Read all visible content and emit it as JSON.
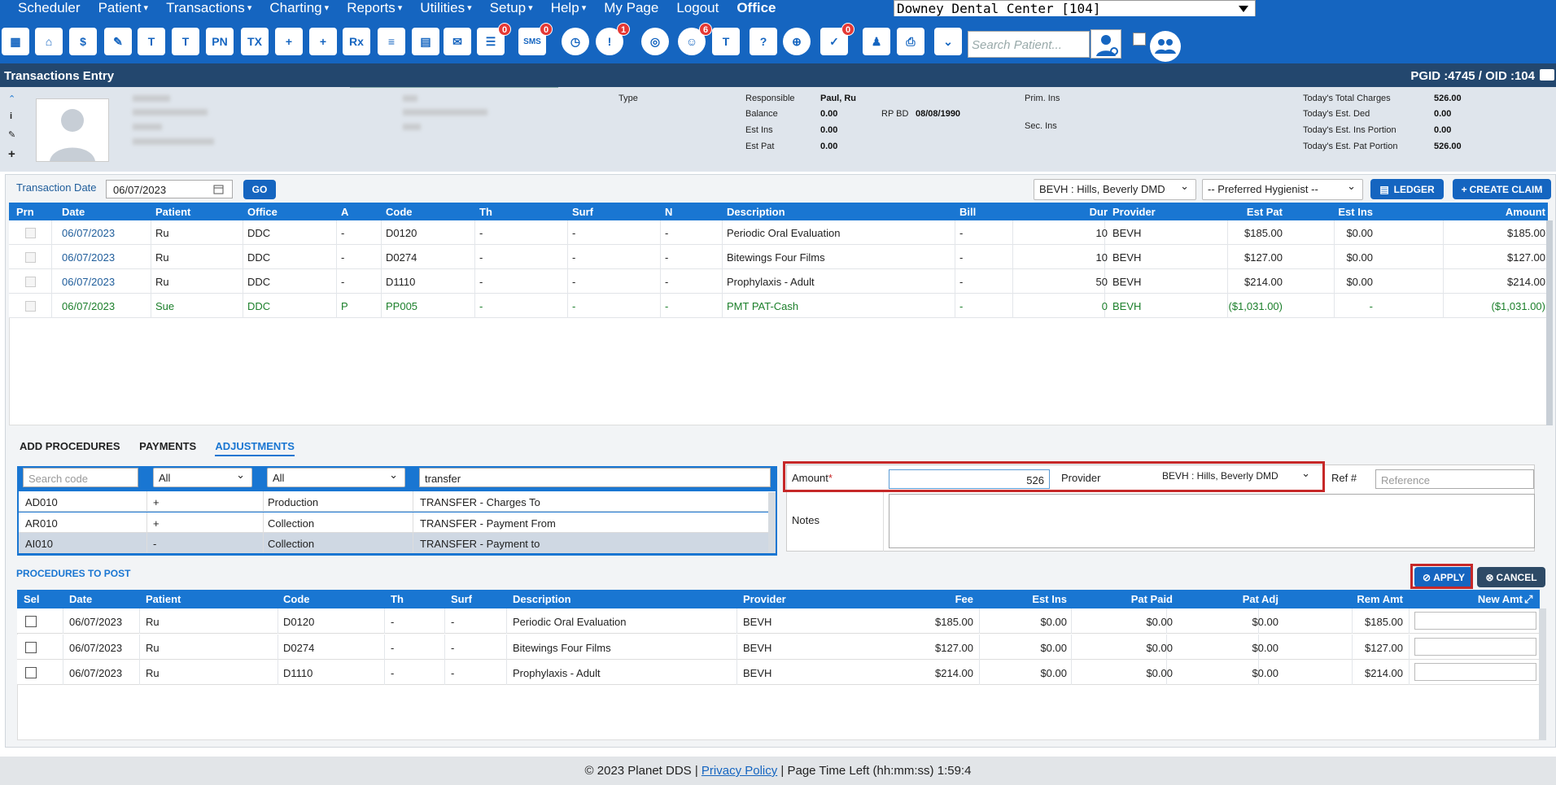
{
  "menu": {
    "items": [
      "Scheduler",
      "Patient",
      "Transactions",
      "Charting",
      "Reports",
      "Utilities",
      "Setup",
      "Help",
      "My Page",
      "Logout"
    ],
    "office_label": "Office",
    "office_value": "Downey Dental Center [104]"
  },
  "toolbar": {
    "search_placeholder": "Search Patient...",
    "icons": [
      {
        "name": "calendar-icon",
        "glyph": "▦"
      },
      {
        "name": "home-icon",
        "glyph": "⌂"
      },
      {
        "name": "dollar-refresh-icon",
        "glyph": "$"
      },
      {
        "name": "edit-notes-icon",
        "glyph": "✎"
      },
      {
        "name": "tooth-icon",
        "glyph": "T"
      },
      {
        "name": "tooth-chart-icon",
        "glyph": "T"
      },
      {
        "name": "progress-notes-icon",
        "glyph": "PN"
      },
      {
        "name": "treatment-icon",
        "glyph": "TX"
      },
      {
        "name": "add-patient-icon",
        "glyph": "+"
      },
      {
        "name": "add-family-icon",
        "glyph": "+"
      },
      {
        "name": "prescription-icon",
        "glyph": "Rx"
      },
      {
        "name": "message-icon",
        "glyph": "≡"
      },
      {
        "name": "print-document-icon",
        "glyph": "▤"
      },
      {
        "name": "email-icon",
        "glyph": "✉"
      },
      {
        "name": "chat-icon",
        "glyph": "☰"
      },
      {
        "name": "sms-icon",
        "glyph": "SMS"
      },
      {
        "name": "clock-icon",
        "glyph": "◷"
      },
      {
        "name": "alerts-icon",
        "glyph": "!"
      },
      {
        "name": "network-icon",
        "glyph": "◎"
      },
      {
        "name": "patient-status-icon",
        "glyph": "☺"
      },
      {
        "name": "tooth-outline-icon",
        "glyph": "T"
      },
      {
        "name": "tooth-help-icon",
        "glyph": "?"
      },
      {
        "name": "globe-icon",
        "glyph": "⊕"
      },
      {
        "name": "checklist-icon",
        "glyph": "✓"
      },
      {
        "name": "users-icon",
        "glyph": "♟"
      },
      {
        "name": "printer-icon",
        "glyph": "⎙"
      },
      {
        "name": "collapse-down-icon",
        "glyph": "⌄"
      }
    ],
    "badges": {
      "chat": "0",
      "sms": "0",
      "alerts": "1",
      "patient_status": "6",
      "checklist": "0"
    }
  },
  "title": {
    "text": "Transactions Entry",
    "ids": "PGID :4745  /  OID :104"
  },
  "patient_panel": {
    "type_label": "Type",
    "responsible_label": "Responsible",
    "responsible": "Paul, Ru",
    "balance_label": "Balance",
    "balance": "0.00",
    "rpbd_label": "RP BD",
    "rpbd": "08/08/1990",
    "estins_label": "Est Ins",
    "estins": "0.00",
    "estpat_label": "Est Pat",
    "estpat": "0.00",
    "primins_label": "Prim. Ins",
    "secins_label": "Sec. Ins",
    "today_charges_label": "Today's Total Charges",
    "today_charges": "526.00",
    "today_ded_label": "Today's Est. Ded",
    "today_ded": "0.00",
    "today_ins_label": "Today's Est. Ins Portion",
    "today_ins": "0.00",
    "today_pat_label": "Today's Est. Pat Portion",
    "today_pat": "526.00"
  },
  "entry": {
    "date_label": "Transaction Date",
    "date": "06/07/2023",
    "go": "GO",
    "provider": "BEVH : Hills, Beverly DMD",
    "hygienist": "-- Preferred Hygienist --",
    "ledger": "LEDGER",
    "create_claim": "CREATE CLAIM"
  },
  "grid": {
    "headers": [
      "Prn",
      "Date",
      "Patient",
      "Office",
      "A",
      "Code",
      "Th",
      "Surf",
      "N",
      "Description",
      "Bill",
      "Dur",
      "Provider",
      "Est Pat",
      "Est Ins",
      "Amount"
    ],
    "rows": [
      {
        "date": "06/07/2023",
        "patient": "Ru",
        "office": "DDC",
        "a": "-",
        "code": "D0120",
        "th": "-",
        "surf": "-",
        "n": "-",
        "desc": "Periodic Oral Evaluation",
        "bill": "-",
        "dur": "10",
        "prov": "BEVH",
        "estpat": "$185.00",
        "estins": "$0.00",
        "amount": "$185.00"
      },
      {
        "date": "06/07/2023",
        "patient": "Ru",
        "office": "DDC",
        "a": "-",
        "code": "D0274",
        "th": "-",
        "surf": "-",
        "n": "-",
        "desc": "Bitewings Four Films",
        "bill": "-",
        "dur": "10",
        "prov": "BEVH",
        "estpat": "$127.00",
        "estins": "$0.00",
        "amount": "$127.00"
      },
      {
        "date": "06/07/2023",
        "patient": "Ru",
        "office": "DDC",
        "a": "-",
        "code": "D1110",
        "th": "-",
        "surf": "-",
        "n": "-",
        "desc": "Prophylaxis - Adult",
        "bill": "-",
        "dur": "50",
        "prov": "BEVH",
        "estpat": "$214.00",
        "estins": "$0.00",
        "amount": "$214.00"
      },
      {
        "date": "06/07/2023",
        "patient": "Sue",
        "office": "DDC",
        "a": "P",
        "code": "PP005",
        "th": "-",
        "surf": "-",
        "n": "-",
        "desc": "PMT PAT-Cash",
        "bill": "-",
        "dur": "0",
        "prov": "BEVH",
        "estpat": "($1,031.00)",
        "estins": "-",
        "amount": "($1,031.00)"
      }
    ]
  },
  "tabs": [
    "ADD PROCEDURES",
    "PAYMENTS",
    "ADJUSTMENTS"
  ],
  "adjust": {
    "search_placeholder": "Search code",
    "filter1": "All",
    "filter2": "All",
    "search_text": "transfer",
    "rows": [
      {
        "code": "AD010",
        "sign": "+",
        "type": "Production",
        "desc": "TRANSFER - Charges To"
      },
      {
        "code": "AR010",
        "sign": "+",
        "type": "Collection",
        "desc": "TRANSFER - Payment From"
      },
      {
        "code": "AI010",
        "sign": "-",
        "type": "Collection",
        "desc": "TRANSFER - Payment to"
      }
    ],
    "amount_label": "Amount",
    "amount": "526",
    "provider_label": "Provider",
    "provider": "BEVH : Hills, Beverly DMD",
    "ref_label": "Ref #",
    "ref_placeholder": "Reference",
    "notes_label": "Notes",
    "apply": "APPLY",
    "cancel": "CANCEL"
  },
  "post": {
    "title": "PROCEDURES TO POST",
    "headers": [
      "Sel",
      "Date",
      "Patient",
      "Code",
      "Th",
      "Surf",
      "Description",
      "Provider",
      "Fee",
      "Est Ins",
      "Pat Paid",
      "Pat Adj",
      "Rem Amt",
      "New Amt"
    ],
    "rows": [
      {
        "date": "06/07/2023",
        "patient": "Ru",
        "code": "D0120",
        "th": "-",
        "surf": "-",
        "desc": "Periodic Oral Evaluation",
        "prov": "BEVH",
        "fee": "$185.00",
        "estins": "$0.00",
        "paid": "$0.00",
        "adj": "$0.00",
        "rem": "$185.00"
      },
      {
        "date": "06/07/2023",
        "patient": "Ru",
        "code": "D0274",
        "th": "-",
        "surf": "-",
        "desc": "Bitewings Four Films",
        "prov": "BEVH",
        "fee": "$127.00",
        "estins": "$0.00",
        "paid": "$0.00",
        "adj": "$0.00",
        "rem": "$127.00"
      },
      {
        "date": "06/07/2023",
        "patient": "Ru",
        "code": "D1110",
        "th": "-",
        "surf": "-",
        "desc": "Prophylaxis - Adult",
        "prov": "BEVH",
        "fee": "$214.00",
        "estins": "$0.00",
        "paid": "$0.00",
        "adj": "$0.00",
        "rem": "$214.00"
      }
    ]
  },
  "footer": {
    "copy": "© 2023 Planet DDS | ",
    "privacy": "Privacy Policy",
    "rest": " |  Page Time Left (hh:mm:ss) 1:59:4"
  }
}
